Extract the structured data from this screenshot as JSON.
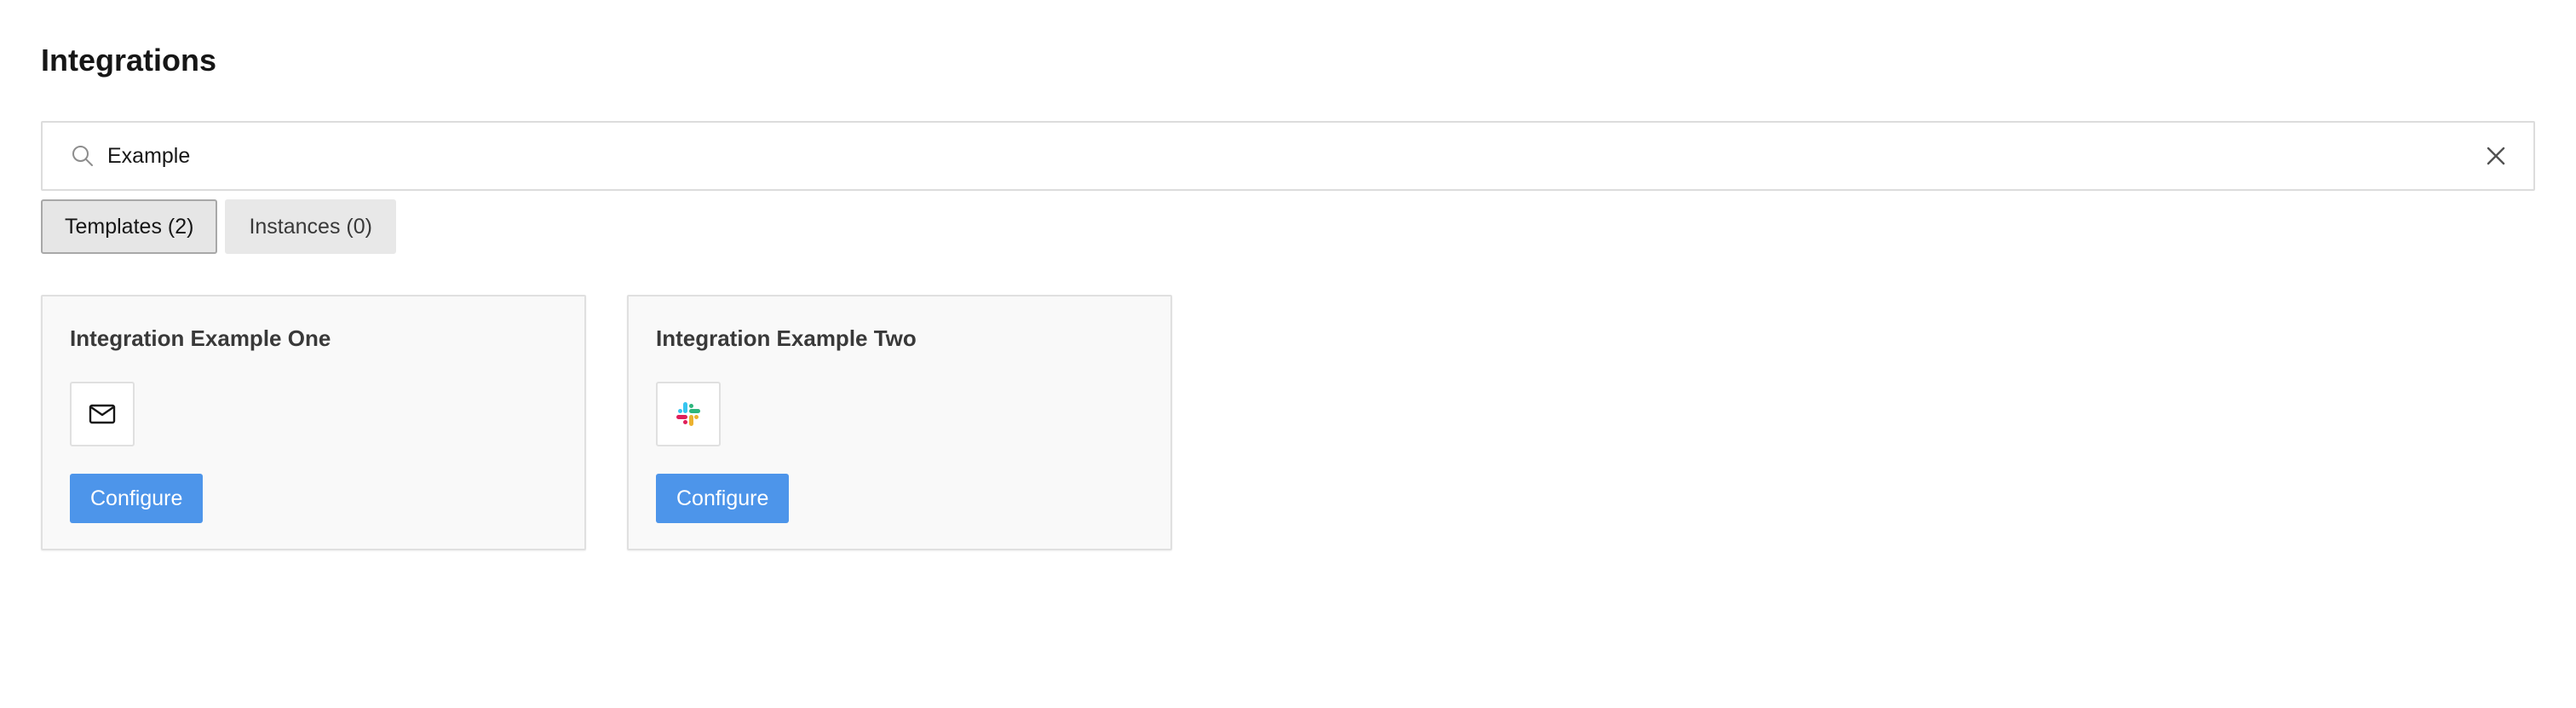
{
  "page": {
    "title": "Integrations"
  },
  "search": {
    "value": "Example",
    "icon": "search-icon",
    "clear_icon": "close-icon"
  },
  "tabs": [
    {
      "label": "Templates (2)",
      "active": true
    },
    {
      "label": "Instances (0)",
      "active": false
    }
  ],
  "cards": [
    {
      "title": "Integration Example One",
      "icon": "mail-icon",
      "button_label": "Configure"
    },
    {
      "title": "Integration Example Two",
      "icon": "slack-icon",
      "button_label": "Configure"
    }
  ],
  "colors": {
    "primary_button": "#4d95ea",
    "card_background": "#f9f9f9",
    "tab_background": "#e8e8e8"
  }
}
